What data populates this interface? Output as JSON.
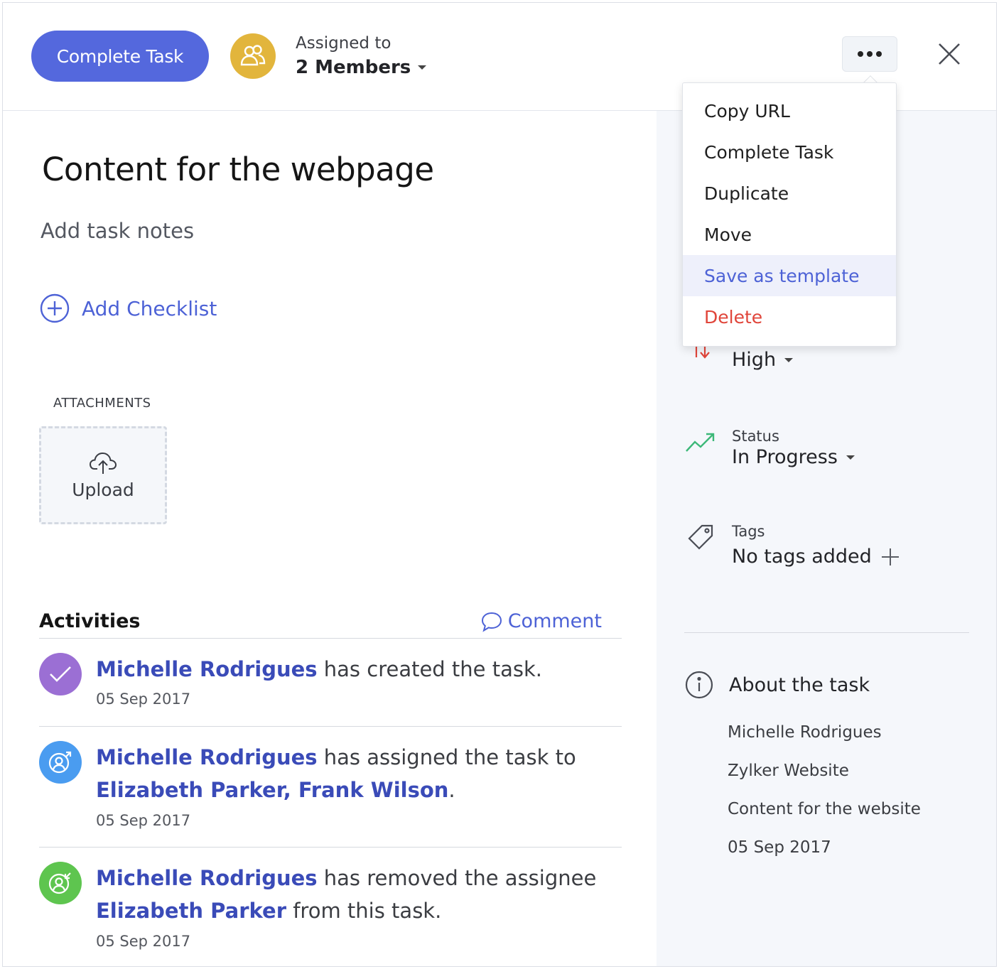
{
  "header": {
    "complete_label": "Complete Task",
    "assigned_label": "Assigned to",
    "members_label": "2 Members"
  },
  "task": {
    "title": "Content for the webpage",
    "notes_placeholder": "Add task notes",
    "add_checklist_label": "Add Checklist",
    "attachments_label": "ATTACHMENTS",
    "upload_label": "Upload"
  },
  "activities": {
    "title": "Activities",
    "comment_label": "Comment",
    "items": [
      {
        "actor": "Michelle Rodrigues",
        "action": " has created the task.",
        "date": "05 Sep 2017",
        "icon_color": "#9b6fd4"
      },
      {
        "actor": "Michelle Rodrigues",
        "action": " has assigned the task to ",
        "target": "Elizabeth Parker, Frank Wilson",
        "tail": ".",
        "date": "05 Sep 2017",
        "icon_color": "#4a9cf0"
      },
      {
        "actor": "Michelle Rodrigues",
        "action": " has removed the assignee ",
        "target": "Elizabeth Parker",
        "tail": " from this task.",
        "date": "05 Sep 2017",
        "icon_color": "#5ec54f"
      }
    ]
  },
  "sidebar": {
    "priority": {
      "value": "High"
    },
    "status": {
      "label": "Status",
      "value": "In Progress"
    },
    "tags": {
      "label": "Tags",
      "value": "No tags added"
    },
    "about": {
      "title": "About the task",
      "items": [
        "Michelle Rodrigues",
        "Zylker Website",
        "Content for the website",
        "05 Sep 2017"
      ]
    }
  },
  "menu": {
    "items": [
      {
        "label": "Copy URL"
      },
      {
        "label": "Complete Task"
      },
      {
        "label": "Duplicate"
      },
      {
        "label": "Move"
      },
      {
        "label": "Save as template",
        "highlighted": true
      },
      {
        "label": "Delete",
        "danger": true
      }
    ]
  },
  "colors": {
    "accent": "#5468dd",
    "link": "#4d62d6",
    "danger": "#e0453a",
    "members_avatar": "#e2b53c",
    "status_icon": "#3cb878",
    "priority_icon": "#e0453a"
  },
  "icons": {
    "members": "people-icon",
    "more": "ellipsis-icon",
    "close": "close-icon",
    "checklist": "plus-circle-icon",
    "upload": "cloud-upload-icon",
    "comment": "speech-bubble-icon",
    "priority": "priority-arrows-icon",
    "status": "trend-up-icon",
    "tags": "tag-icon",
    "about": "info-icon"
  }
}
